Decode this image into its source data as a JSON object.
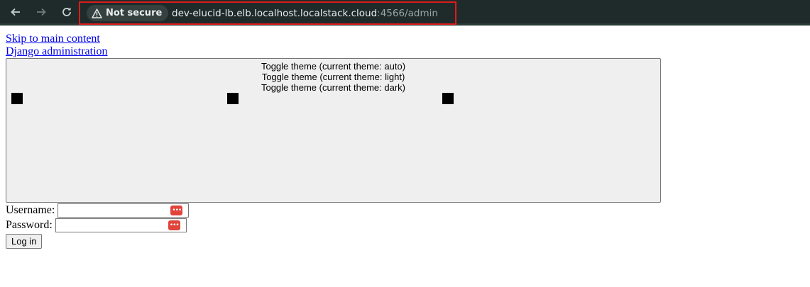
{
  "browser": {
    "security_label": "Not secure",
    "url_host": "dev-elucid-lb.elb.localhost.localstack.cloud",
    "url_path": ":4566/admin",
    "highlight_color": "#e01b1b",
    "toolbar_color": "#1f2b2a"
  },
  "page": {
    "skip_link": "Skip to main content",
    "site_link": "Django administration",
    "theme_toggle": {
      "lines": [
        "Toggle theme (current theme: auto)",
        "Toggle theme (current theme: light)",
        "Toggle theme (current theme: dark)"
      ]
    },
    "form": {
      "username_label": "Username:",
      "username_value": "",
      "password_label": "Password:",
      "password_value": "",
      "password_manager_icon": "key-icon",
      "submit_label": "Log in"
    },
    "link_color": "#0000ee"
  }
}
